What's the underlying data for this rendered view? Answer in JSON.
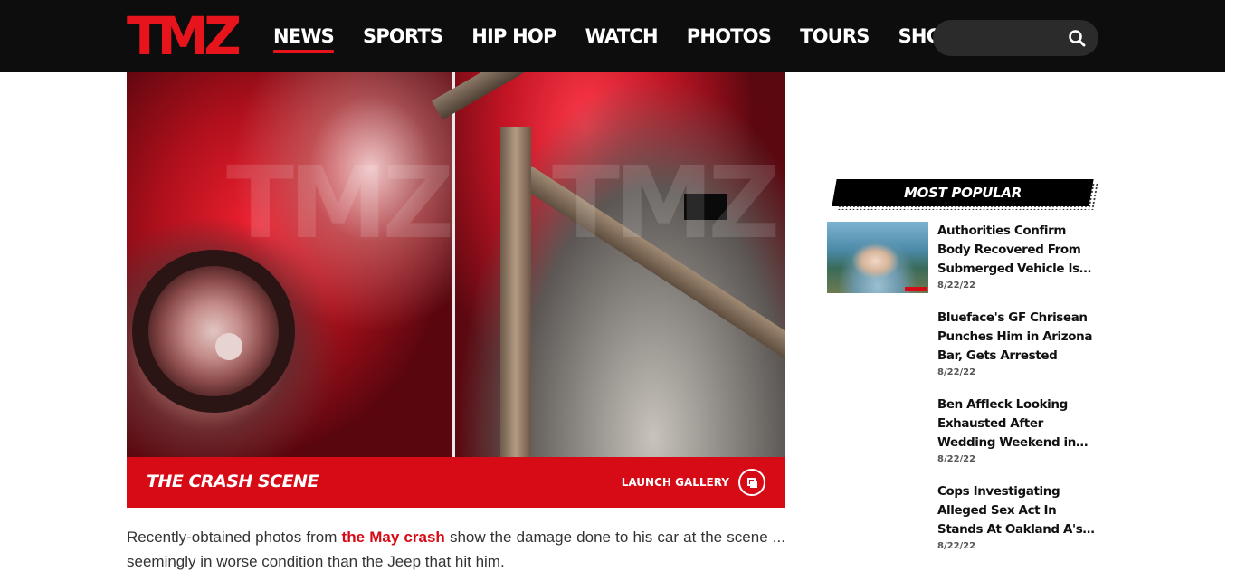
{
  "header": {
    "logo_text": "TMZ",
    "nav": [
      {
        "label": "NEWS",
        "active": true
      },
      {
        "label": "SPORTS",
        "active": false
      },
      {
        "label": "HIP HOP",
        "active": false
      },
      {
        "label": "WATCH",
        "active": false
      },
      {
        "label": "PHOTOS",
        "active": false
      },
      {
        "label": "TOURS",
        "active": false
      },
      {
        "label": "SHOP",
        "active": false
      }
    ],
    "search": {
      "placeholder": "",
      "icon": "search-icon"
    }
  },
  "gallery": {
    "watermark": "TMZ",
    "caption_title": "THE CRASH SCENE",
    "launch_label": "LAUNCH GALLERY",
    "launch_icon": "gallery-icon"
  },
  "article": {
    "text_before": "Recently-obtained photos from ",
    "link_text": "the May crash",
    "text_after": " show the damage done to his car at the scene ... seemingly in worse condition than the Jeep that hit him."
  },
  "most_popular": {
    "heading": "MOST POPULAR",
    "items": [
      {
        "title": "Authorities Confirm Body Recovered From Submerged Vehicle Is Kie...",
        "date": "8/22/22",
        "has_thumb": true
      },
      {
        "title": "Blueface's GF Chrisean Punches Him in Arizona Bar, Gets Arrested",
        "date": "8/22/22",
        "has_thumb": false
      },
      {
        "title": "Ben Affleck Looking Exhausted After Wedding Weekend in Georgia",
        "date": "8/22/22",
        "has_thumb": false
      },
      {
        "title": "Cops Investigating Alleged Sex Act In Stands At Oakland A's Game",
        "date": "8/22/22",
        "has_thumb": false
      }
    ]
  },
  "colors": {
    "brand_red": "#d70b16",
    "header_bg": "#0d0d0d"
  }
}
